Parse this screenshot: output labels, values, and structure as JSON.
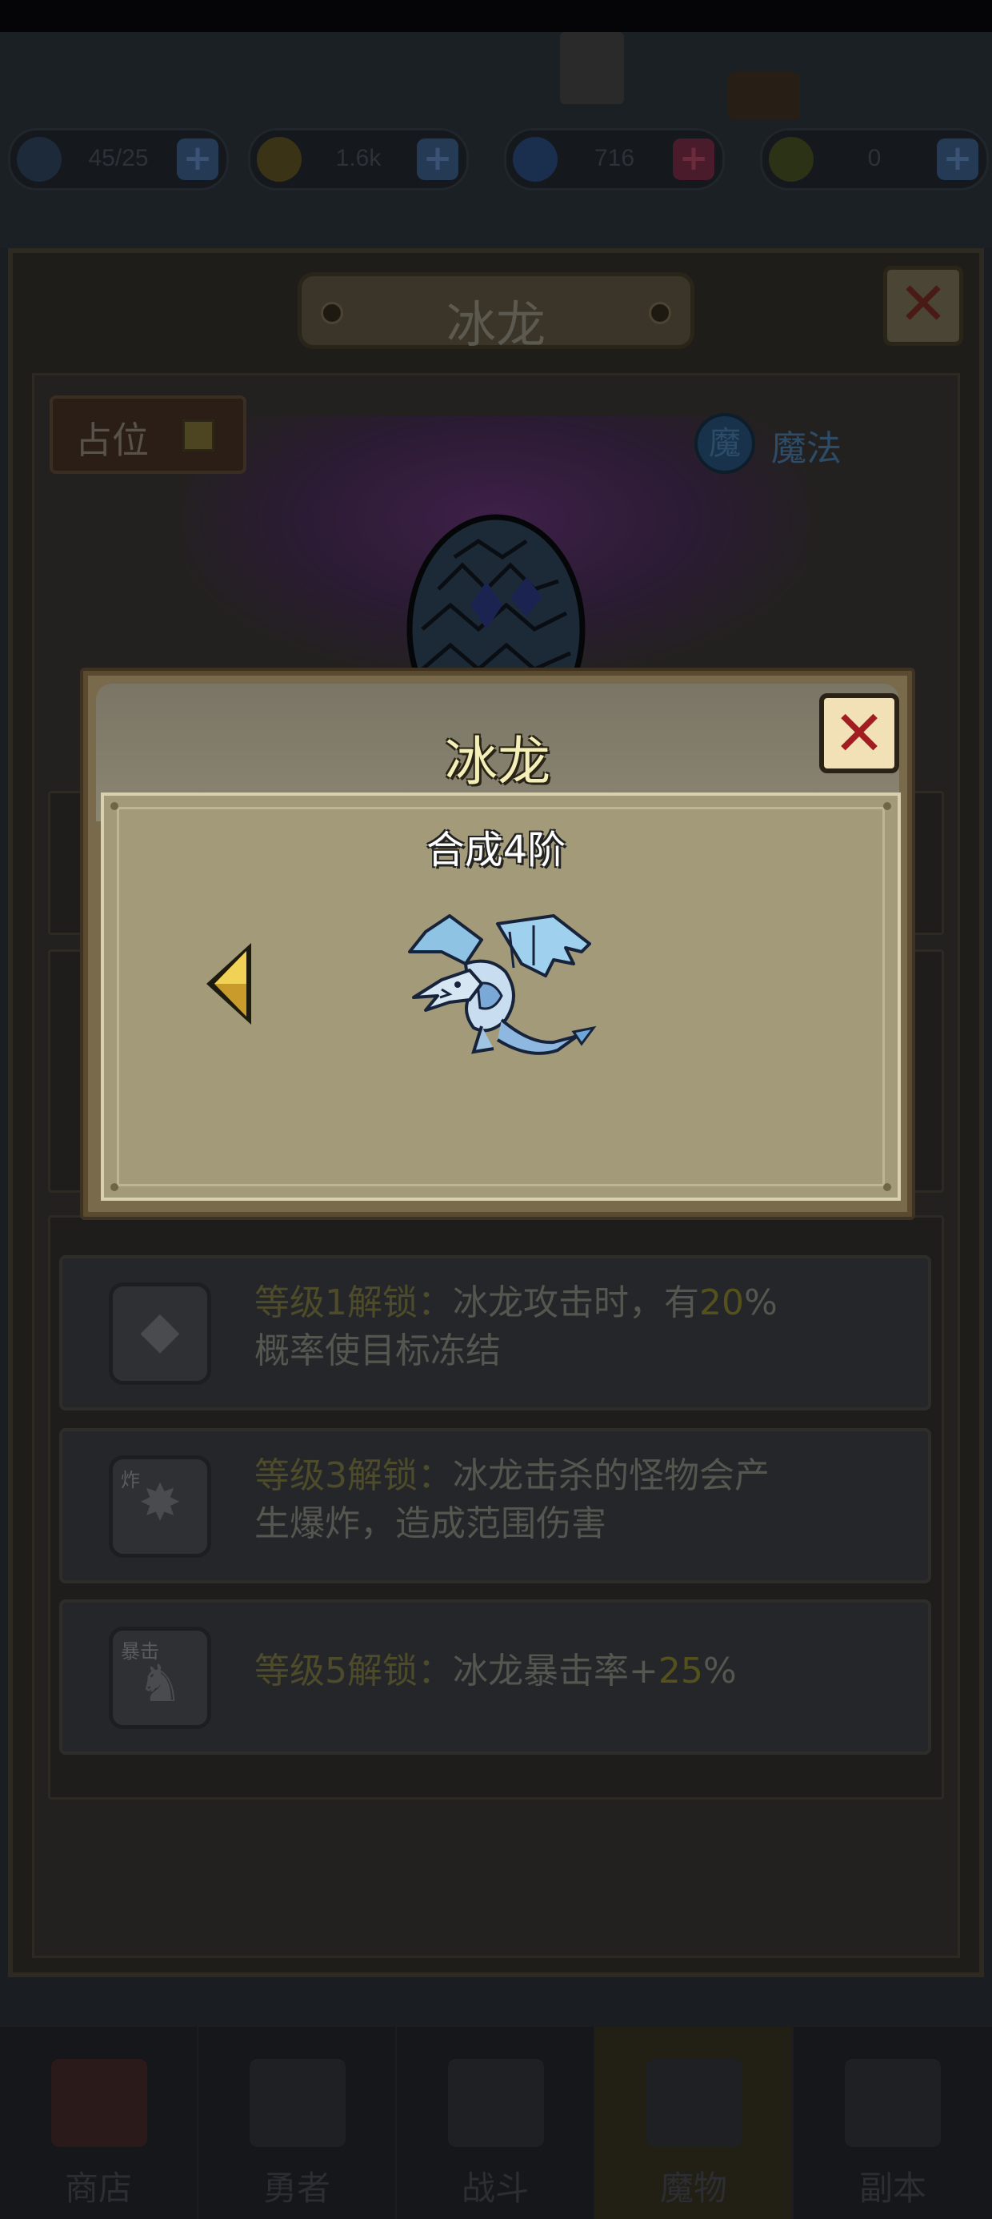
{
  "resources": [
    {
      "icon": "energy-icon",
      "value": "45/25"
    },
    {
      "icon": "gold-coin-icon",
      "value": "1.6k"
    },
    {
      "icon": "diamond-icon",
      "value": "716"
    },
    {
      "icon": "shield-token-icon",
      "value": "0"
    }
  ],
  "panel": {
    "title": "冰龙",
    "close_label": "✕",
    "occupy_label": "占位",
    "type_badge": "魔",
    "type_label": "魔法"
  },
  "skills": [
    {
      "icon": "frozen-golem-icon",
      "icon_tag": "",
      "unlock": "等级1解锁：",
      "text_a": "冰龙攻击时，有",
      "pct": "20",
      "text_b": "%",
      "line2": "概率使目标冻结"
    },
    {
      "icon": "explosion-icon",
      "icon_tag": "炸",
      "unlock": "等级3解锁：",
      "text_a": "冰龙击杀的怪物会产",
      "pct": "",
      "text_b": "",
      "line2": "生爆炸，造成范围伤害"
    },
    {
      "icon": "critical-dragon-icon",
      "icon_tag": "暴击",
      "unlock": "等级5解锁：",
      "text_a": "冰龙暴击率+",
      "pct": "25",
      "text_b": "%",
      "line2": ""
    }
  ],
  "modal": {
    "title": "冰龙",
    "close_label": "✕",
    "stage_label": "合成4阶"
  },
  "nav": [
    {
      "icon": "shop-icon",
      "label": "商店",
      "active": false
    },
    {
      "icon": "hero-icon",
      "label": "勇者",
      "active": false
    },
    {
      "icon": "battle-icon",
      "label": "战斗",
      "active": false
    },
    {
      "icon": "monster-icon",
      "label": "魔物",
      "active": true
    },
    {
      "icon": "dungeon-icon",
      "label": "副本",
      "active": false
    }
  ],
  "colors": {
    "modal_title": "#f4efb9",
    "close_x": "#a21d22",
    "arrow_gold": "#e8c23a",
    "dragon_ice": "#9ccbe6"
  }
}
